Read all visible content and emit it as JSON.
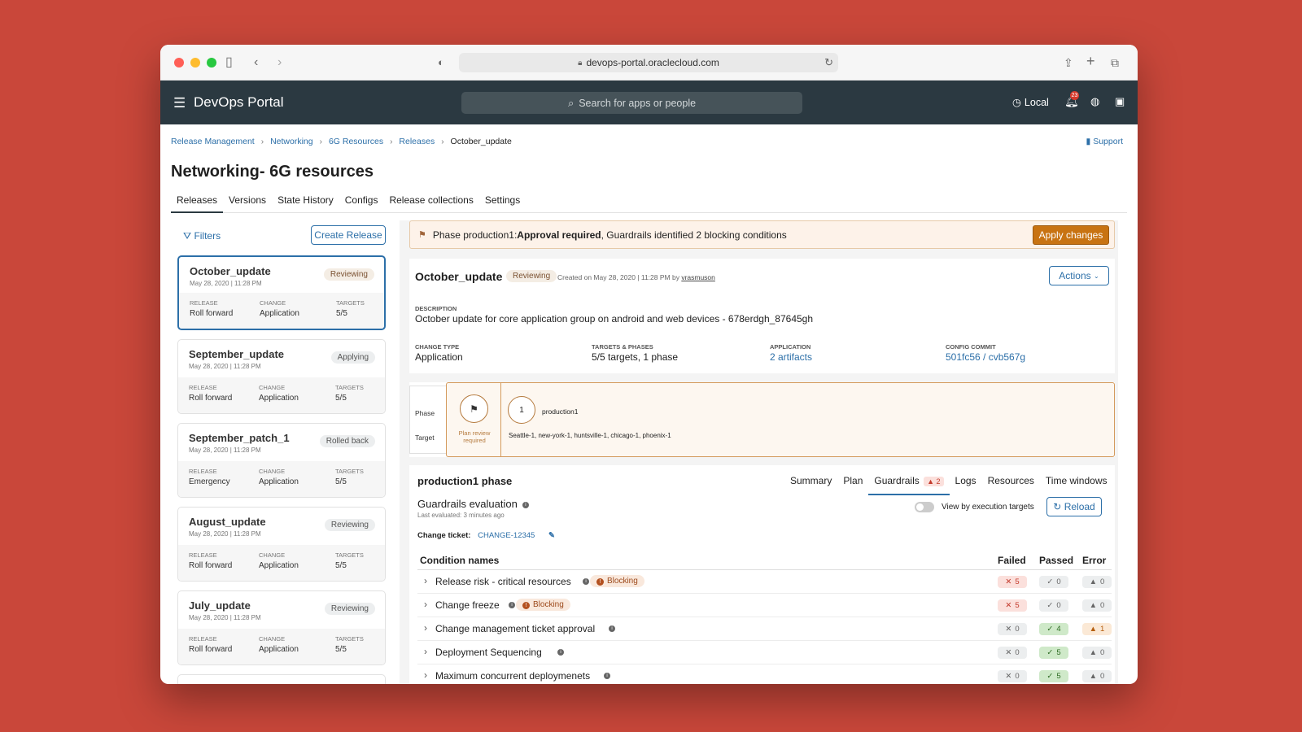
{
  "browser": {
    "url": "devops-portal.oraclecloud.com"
  },
  "app": {
    "title": "DevOps Portal",
    "search_placeholder": "Search for apps or people",
    "region": "Local",
    "notification_count": "23"
  },
  "breadcrumb": [
    "Release Management",
    "Networking",
    "6G Resources",
    "Releases",
    "October_update"
  ],
  "support": "Support",
  "page_title": "Networking- 6G resources",
  "tabs": [
    "Releases",
    "Versions",
    "State History",
    "Configs",
    "Release collections",
    "Settings"
  ],
  "left": {
    "filters": "Filters",
    "create": "Create Release",
    "col_labels": [
      "RELEASE",
      "CHANGE",
      "TARGETS"
    ],
    "releases": [
      {
        "name": "October_update",
        "date": "May 28, 2020 | 11:28 PM",
        "status": "Reviewing",
        "release": "Roll forward",
        "change": "Application",
        "targets": "5/5"
      },
      {
        "name": "September_update",
        "date": "May 28, 2020 | 11:28 PM",
        "status": "Applying",
        "release": "Roll forward",
        "change": "Application",
        "targets": "5/5"
      },
      {
        "name": "September_patch_1",
        "date": "May 28, 2020 | 11:28 PM",
        "status": "Rolled back",
        "release": "Emergency",
        "change": "Application",
        "targets": "5/5"
      },
      {
        "name": "August_update",
        "date": "May 28, 2020 | 11:28 PM",
        "status": "Reviewing",
        "release": "Roll forward",
        "change": "Application",
        "targets": "5/5"
      },
      {
        "name": "July_update",
        "date": "May 28, 2020 | 11:28 PM",
        "status": "Reviewing",
        "release": "Roll forward",
        "change": "Application",
        "targets": "5/5"
      }
    ]
  },
  "alert": {
    "prefix": "Phase production1: ",
    "bold": "Approval required",
    "suffix": ", Guardrails identified 2 blocking conditions",
    "button": "Apply changes"
  },
  "detail": {
    "name": "October_update",
    "status": "Reviewing",
    "created_prefix": "Created on May 28, 2020 | 11:28 PM by ",
    "created_by": "vrasmuson",
    "actions": "Actions",
    "description_label": "DESCRIPTION",
    "description": "October update for core application group on android and web devices - 678erdgh_87645gh",
    "change_type_label": "CHANGE TYPE",
    "change_type": "Application",
    "targets_label": "TARGETS & PHASES",
    "targets": "5/5 targets, 1 phase",
    "application_label": "APPLICATION",
    "application": "2 artifacts",
    "commit_label": "CONFIG COMMIT",
    "commit": "501fc56 / cvb567g"
  },
  "phase": {
    "phase_label": "Phase",
    "target_label": "Target",
    "plan_text": "Plan review required",
    "number": "1",
    "name": "production1",
    "targets": "Seattle-1, new-york-1, huntsville-1, chicago-1, phoenix-1"
  },
  "guardrails": {
    "phase_title": "production1 phase",
    "tabs": [
      "Summary",
      "Plan",
      "Guardrails",
      "Logs",
      "Resources",
      "Time windows"
    ],
    "guardrail_count": "2",
    "eval_title": "Guardrails evaluation",
    "last_evaluated": "Last evaluated: 3 minutes ago",
    "toggle_label": "View by execution targets",
    "reload": "Reload",
    "ticket_label": "Change ticket:",
    "ticket": "CHANGE-12345",
    "headers": [
      "Condition names",
      "Failed",
      "Passed",
      "Error"
    ],
    "blocking_label": "Blocking",
    "rows": [
      {
        "name": "Release risk - critical resources",
        "blocking": true,
        "failed": "5",
        "passed": "0",
        "error": "0"
      },
      {
        "name": "Change freeze",
        "blocking": true,
        "failed": "5",
        "passed": "0",
        "error": "0"
      },
      {
        "name": "Change management ticket approval",
        "blocking": false,
        "failed": "0",
        "passed": "4",
        "error": "1"
      },
      {
        "name": "Deployment Sequencing",
        "blocking": false,
        "failed": "0",
        "passed": "5",
        "error": "0"
      },
      {
        "name": "Maximum concurrent deploymenets",
        "blocking": false,
        "failed": "0",
        "passed": "5",
        "error": "0"
      }
    ]
  }
}
